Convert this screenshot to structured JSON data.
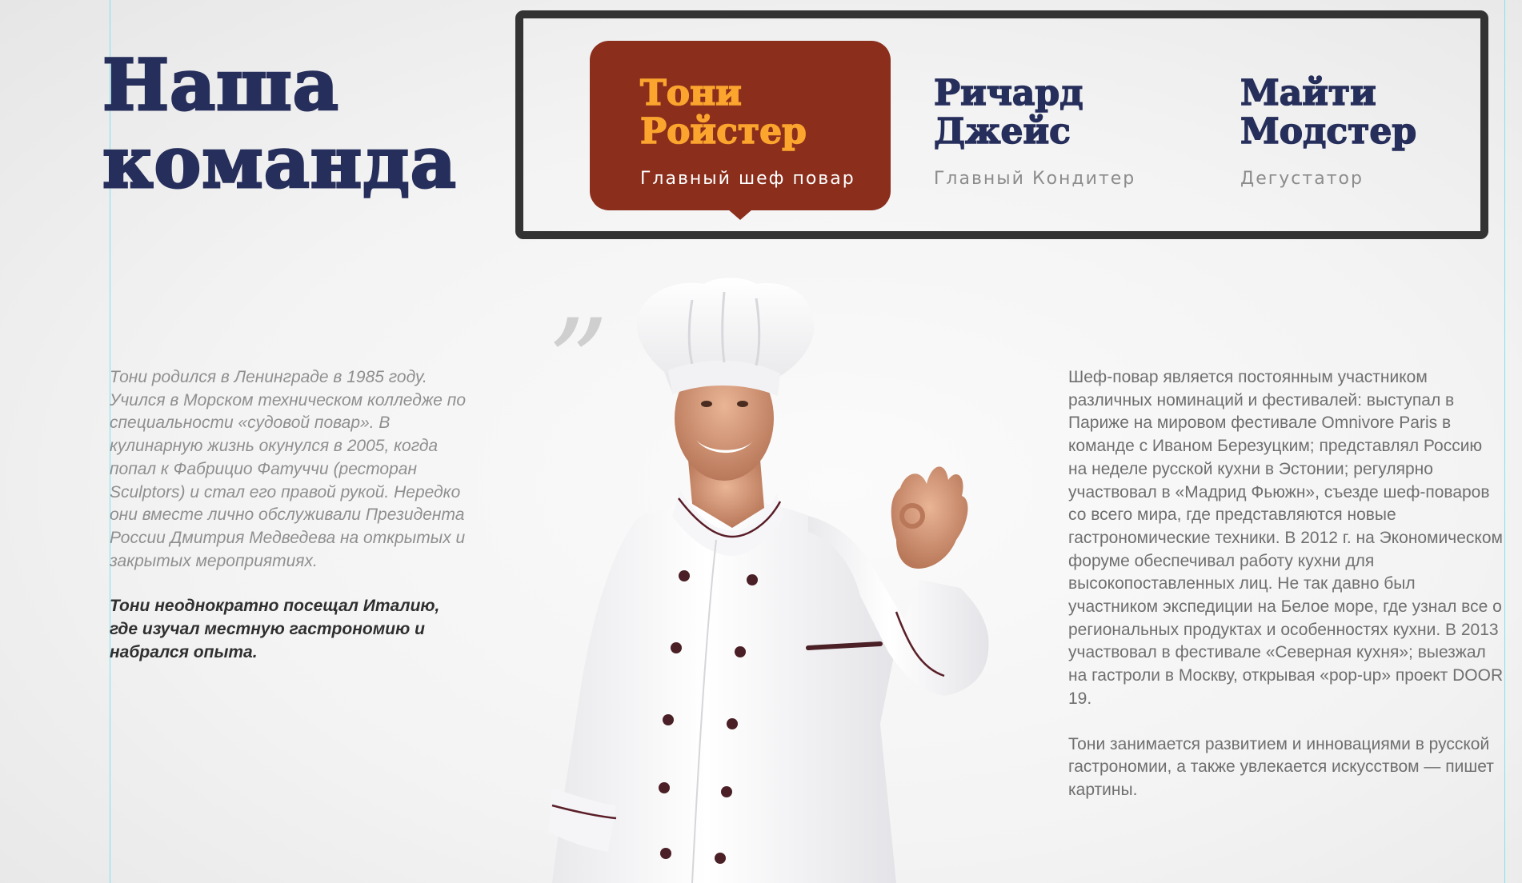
{
  "title": {
    "line1": "Наша",
    "line2": "команда"
  },
  "team": [
    {
      "name_line1": "Тони",
      "name_line2": "Ройстер",
      "role": "Главный шеф повар",
      "active": true
    },
    {
      "name_line1": "Ричард",
      "name_line2": "Джейс",
      "role": "Главный Кондитер",
      "active": false
    },
    {
      "name_line1": "Майти",
      "name_line2": "Модстер",
      "role": "Дегустатор",
      "active": false
    }
  ],
  "quote_mark": "”",
  "bio_left": {
    "paragraph": "Тони родился в Ленинграде в 1985 году. Учился в Морском техническом колледже по специальности «судовой повар». В кулинарную жизнь окунулся в 2005, когда попал к Фабрицио Фатуччи (ресторан Sculptors) и стал его правой рукой. Нередко они вместе лично обслуживали Президента России Дмитрия Медведева на открытых и закрытых мероприятиях.",
    "emphasis": "Тони неоднократно посещал Италию, где изучал местную гастрономию и набрался опыта."
  },
  "bio_right": {
    "paragraph1": "Шеф-повар является постоянным участником различных номинаций и фестивалей: выступал в Париже на мировом фестивале Omnivore Paris в команде с Иваном Березуцким; представлял Россию на неделе русской кухни в Эстонии; регулярно участвовал в «Мадрид Фьюжн», съезде шеф-поваров со всего мира, где представляются новые гастрономические техники. В 2012 г. на Экономическом форуме обеспечивал работу кухни для высокопоставленных лиц. Не так давно был участником экспедиции на Белое море, где узнал все о региональных продуктах и особенностях кухни. В 2013 участвовал в фестивале «Северная кухня»; выезжал на гастроли в Москву, открывая «pop-up» проект DOOR 19.",
    "paragraph2": "Тони занимается развитием и инновациями в русской гастрономии, а также увлекается искусством — пишет картины."
  },
  "colors": {
    "navy": "#262e5b",
    "active_card": "#8b2e1c",
    "active_name": "#fba52e",
    "panel_border": "#333333"
  },
  "image": {
    "subject": "chef-portrait-ok-gesture"
  }
}
